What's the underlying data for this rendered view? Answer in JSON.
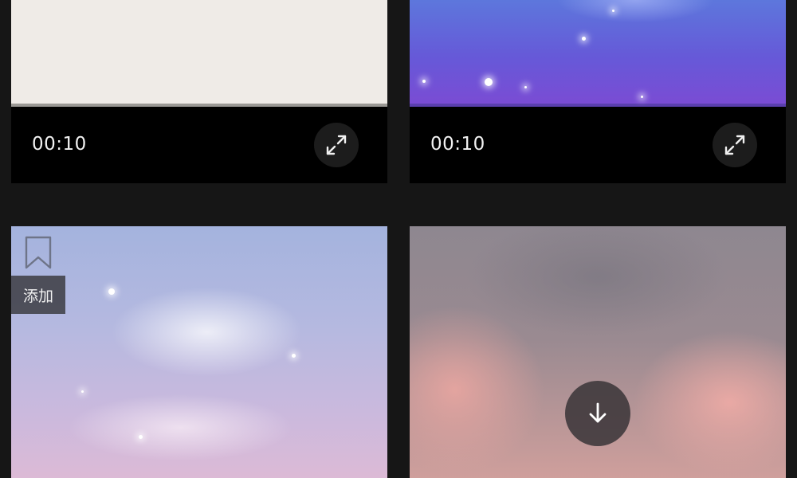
{
  "cards": [
    {
      "duration": "00:10",
      "expand_icon": "expand-icon",
      "colors": {
        "thumbnail": "#efebe7",
        "bar": "#000000"
      }
    },
    {
      "duration": "00:10",
      "expand_icon": "expand-icon",
      "colors": {
        "thumbnail": "#6659d8",
        "bar": "#000000"
      }
    },
    {
      "bookmark_icon": "bookmark-icon",
      "add_label": "添加",
      "colors": {
        "thumbnail": "#b5b9e0"
      }
    },
    {
      "download_icon": "download-arrow-icon",
      "colors": {
        "thumbnail": "#cf9f9c"
      }
    }
  ],
  "theme": {
    "background": "#161616",
    "text": "#f2f2f2"
  }
}
